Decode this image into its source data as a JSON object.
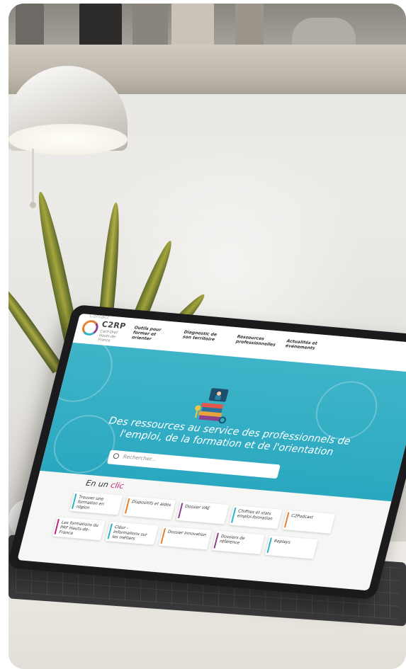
{
  "site": {
    "top_links": "  Contact",
    "logo": {
      "name": "C2RP",
      "subtitle": "Carif-Oref Hauts-de-France"
    },
    "nav": [
      {
        "label": "Outils pour former et orienter"
      },
      {
        "label": "Diagnostic de son territoire"
      },
      {
        "label": "Ressources professionnelles"
      },
      {
        "label": "Actualités et événements"
      }
    ],
    "hero": {
      "title_line1": "Des ressources au service des professionnels de",
      "title_line2": "l'emploi, de la formation et de l'orientation",
      "search_placeholder": "Rechercher..."
    },
    "quick_links": {
      "heading_prefix": "En un ",
      "heading_accent": "clic",
      "cards": [
        {
          "label": "Trouver une formation en région",
          "color": "#2bb3c7"
        },
        {
          "label": "Dispositifs et aides",
          "color": "#e87d2a"
        },
        {
          "label": "Dossier VAE",
          "color": "#8e3f8d"
        },
        {
          "label": "Chiffres et stats emploi-formation",
          "color": "#2bb3c7"
        },
        {
          "label": "C2Podcast",
          "color": "#e87d2a"
        },
        {
          "label": "Les formations du PRF Hauts-de-France",
          "color": "#c0207e"
        },
        {
          "label": "Cléor - Informations sur les métiers",
          "color": "#2bb3c7"
        },
        {
          "label": "Dossier Innovation",
          "color": "#e87d2a"
        },
        {
          "label": "Dossiers de référence",
          "color": "#8e3f8d"
        },
        {
          "label": "Replays",
          "color": "#2bb3c7"
        }
      ]
    }
  },
  "colors": {
    "hero": "#2aa8bf",
    "accent_pink": "#c0207e",
    "accent_orange": "#e87d2a",
    "accent_purple": "#8e3f8d"
  }
}
